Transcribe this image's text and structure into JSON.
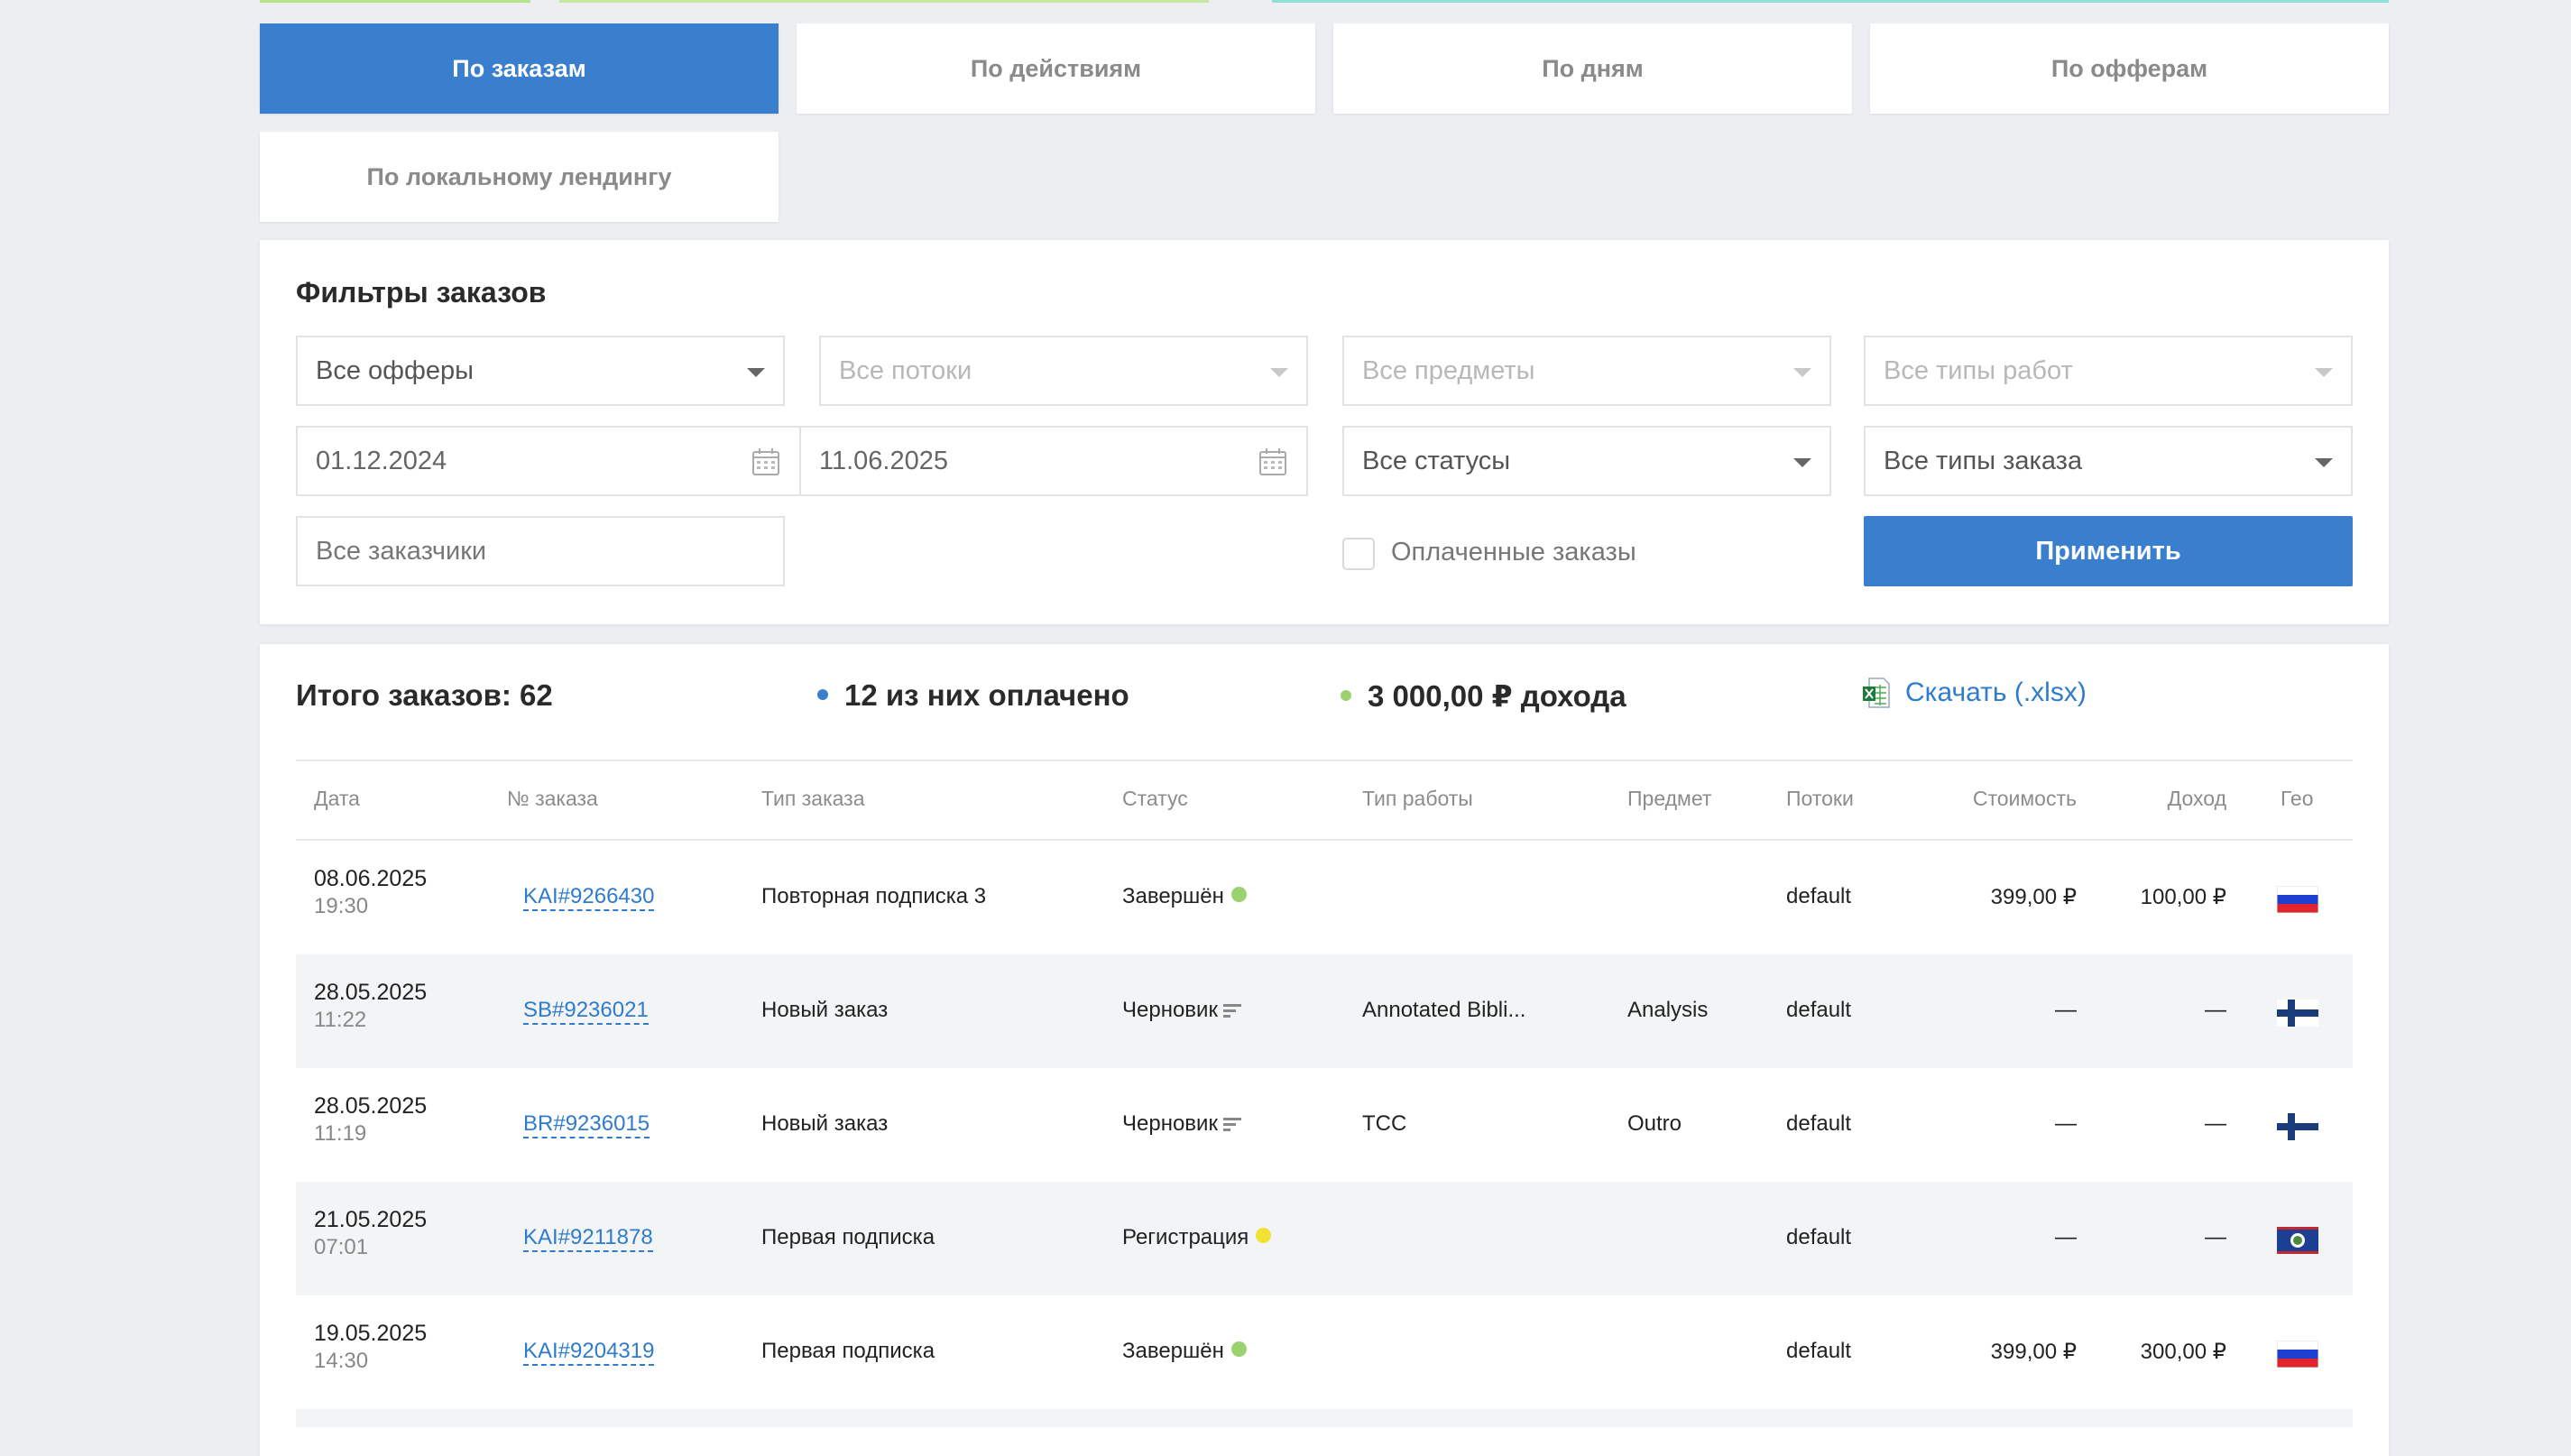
{
  "tabs": [
    "По заказам",
    "По действиям",
    "По дням",
    "По офферам",
    "По локальному лендингу"
  ],
  "filters": {
    "title": "Фильтры заказов",
    "offers": "Все офферы",
    "streams": "Все потоки",
    "subjects": "Все предметы",
    "work_types": "Все типы работ",
    "date_from": "01.12.2024",
    "date_to": "11.06.2025",
    "statuses": "Все статусы",
    "order_types": "Все типы заказа",
    "customers": "Все заказчики",
    "paid_label": "Оплаченные заказы",
    "apply_label": "Применить"
  },
  "summary": {
    "total": "Итого заказов: 62",
    "paid": "12 из них оплачено",
    "income": "3 000,00 ₽ дохода",
    "download": "Скачать (.xlsx)",
    "paid_color": "#3a7fce",
    "income_color": "#9bd16f"
  },
  "table": {
    "headers": [
      "Дата",
      "№ заказа",
      "Тип заказа",
      "Статус",
      "Тип работы",
      "Предмет",
      "Потоки",
      "Стоимость",
      "Доход",
      "Гео"
    ],
    "rows": [
      {
        "date": "08.06.2025",
        "time": "19:30",
        "order": "KAI#9266430",
        "type": "Повторная подписка 3",
        "status": "Завершён",
        "status_icon": "green-dot",
        "work": "",
        "subject": "",
        "stream": "default",
        "cost": "399,00 ₽",
        "income": "100,00 ₽",
        "geo": "ru-flag"
      },
      {
        "date": "28.05.2025",
        "time": "11:22",
        "order": "SB#9236021",
        "type": "Новый заказ",
        "status": "Черновик",
        "status_icon": "draft-icon",
        "work": "Annotated Bibli...",
        "subject": "Analysis",
        "stream": "default",
        "cost": "—",
        "income": "—",
        "geo": "fi-flag"
      },
      {
        "date": "28.05.2025",
        "time": "11:19",
        "order": "BR#9236015",
        "type": "Новый заказ",
        "status": "Черновик",
        "status_icon": "draft-icon",
        "work": "TCC",
        "subject": "Outro",
        "stream": "default",
        "cost": "—",
        "income": "—",
        "geo": "fi-flag"
      },
      {
        "date": "21.05.2025",
        "time": "07:01",
        "order": "KAI#9211878",
        "type": "Первая подписка",
        "status": "Регистрация",
        "status_icon": "yellow-dot",
        "work": "",
        "subject": "",
        "stream": "default",
        "cost": "—",
        "income": "—",
        "geo": "bz-flag"
      },
      {
        "date": "19.05.2025",
        "time": "14:30",
        "order": "KAI#9204319",
        "type": "Первая подписка",
        "status": "Завершён",
        "status_icon": "green-dot",
        "work": "",
        "subject": "",
        "stream": "default",
        "cost": "399,00 ₽",
        "income": "300,00 ₽",
        "geo": "ru-flag"
      }
    ]
  },
  "colors": {
    "accent": "#3a7fce",
    "status_green": "#9bd16f",
    "status_yellow": "#f3e233"
  }
}
